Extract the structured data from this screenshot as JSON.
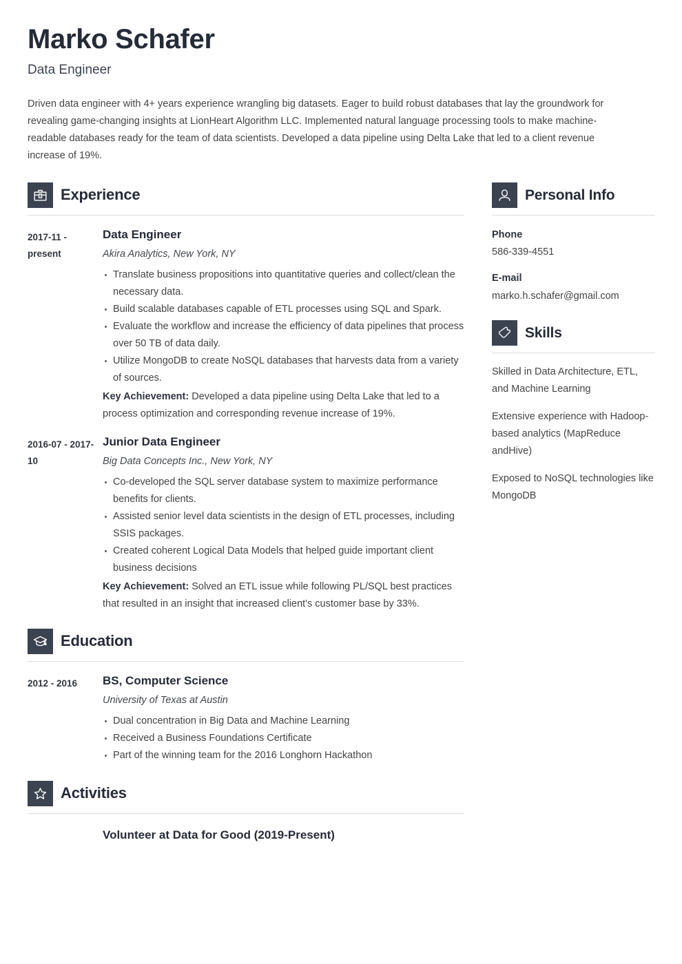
{
  "header": {
    "name": "Marko Schafer",
    "job_title": "Data Engineer",
    "summary": "Driven data engineer with 4+ years experience wrangling big datasets. Eager to build robust databases that lay the groundwork for revealing game-changing insights at LionHeart Algorithm LLC. Implemented natural language processing tools to make machine-readable databases ready for the team of data scientists. Developed a data pipeline using Delta Lake that led to a client revenue increase of 19%."
  },
  "accent_color": "#3b4250",
  "heading_color": "#262b37",
  "body_color": "#444444",
  "rule_color": "#dcdcdc",
  "sections": {
    "experience": {
      "title": "Experience",
      "icon": "briefcase-icon",
      "entries": [
        {
          "dates": "2017-11 - present",
          "title": "Data Engineer",
          "subtitle": "Akira Analytics, New York, NY",
          "bullets": [
            "Translate business propositions into quantitative queries and collect/clean the necessary data.",
            "Build scalable databases capable of ETL processes using SQL and Spark.",
            "Evaluate the workflow and increase the efficiency of data pipelines that process over 50 TB of data daily.",
            "Utilize MongoDB to create NoSQL databases that harvests data from a variety of sources."
          ],
          "key_achievement_label": "Key Achievement:",
          "key_achievement_text": "Developed a data pipeline using Delta Lake that led to a process optimization and corresponding revenue increase of 19%."
        },
        {
          "dates": "2016-07 - 2017-10",
          "title": "Junior Data Engineer",
          "subtitle": "Big Data Concepts Inc., New York, NY",
          "bullets": [
            "Co-developed the SQL server database system to maximize performance benefits for clients.",
            "Assisted senior level data scientists in the design of ETL processes, including SSIS packages.",
            "Created coherent Logical Data Models that helped guide important client business decisions"
          ],
          "key_achievement_label": "Key Achievement:",
          "key_achievement_text": "Solved an ETL issue while following PL/SQL best practices that resulted in an insight that increased client's customer base by 33%."
        }
      ]
    },
    "education": {
      "title": "Education",
      "icon": "graduation-cap-icon",
      "entries": [
        {
          "dates": "2012 - 2016",
          "title": "BS, Computer Science",
          "subtitle": "University of Texas at Austin",
          "bullets": [
            "Dual concentration in Big Data and Machine Learning",
            "Received a Business Foundations Certificate",
            "Part of the winning team for the 2016 Longhorn Hackathon"
          ]
        }
      ]
    },
    "activities": {
      "title": "Activities",
      "icon": "star-icon",
      "items": [
        "Volunteer at Data for Good (2019-Present)"
      ]
    },
    "personal_info": {
      "title": "Personal Info",
      "icon": "person-icon",
      "fields": [
        {
          "label": "Phone",
          "value": "586-339-4551"
        },
        {
          "label": "E-mail",
          "value": "marko.h.schafer@gmail.com"
        }
      ]
    },
    "skills": {
      "title": "Skills",
      "icon": "puzzle-piece-icon",
      "items": [
        "Skilled in Data Architecture, ETL, and Machine Learning",
        "Extensive experience with Hadoop-based analytics (MapReduce andHive)",
        "Exposed to NoSQL technologies like MongoDB"
      ]
    }
  }
}
